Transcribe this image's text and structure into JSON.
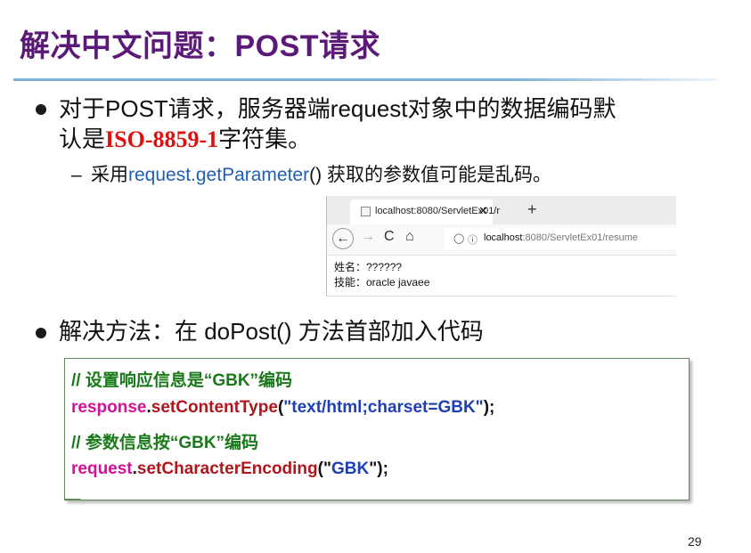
{
  "title": "解决中文问题：POST请求",
  "bullet1": {
    "line1": "对于POST请求，服务器端request对象中的数据编码默",
    "line2_prefix": "认是",
    "encoding": "ISO-8859-1",
    "line2_suffix": "字符集。"
  },
  "sub": {
    "dash": "–",
    "prefix": "采用",
    "method": "request.getParameter",
    "suffix_paren": "()",
    "suffix": " 获取的参数值可能是乱码。"
  },
  "browser": {
    "tab_title": "localhost:8080/ServletEx01/r",
    "tab_close": "✕",
    "new_tab": "+",
    "back": "←",
    "forward": "→",
    "reload": "C",
    "home": "⌂",
    "url_host": "localhost",
    "url_path": ":8080/ServletEx01/resume",
    "content_line1": "姓名：??????",
    "content_line2": "技能：oracle javaee"
  },
  "bullet2": "解决方法：在 doPost() 方法首部加入代码",
  "code": {
    "comment1": "// 设置响应信息是“GBK”编码",
    "l2_obj": "response",
    "l2_dot": ".",
    "l2_method": "setContentType",
    "l2_open": "(",
    "l2_str": "\"text/html;charset=GBK\"",
    "l2_close": ");",
    "comment2": "// 参数信息按“GBK”编码",
    "l4_obj": "request",
    "l4_dot": ".",
    "l4_method": "setCharacterEncoding",
    "l4_open": "(",
    "l4_str1": "\"",
    "l4_str": "GBK",
    "l4_str2": "\"",
    "l4_close": ");"
  },
  "page_number": "29"
}
